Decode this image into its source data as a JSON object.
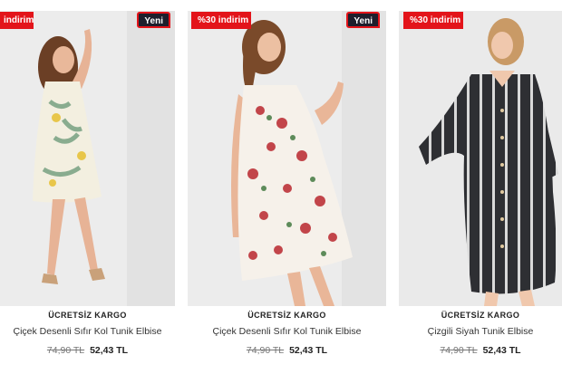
{
  "products": [
    {
      "discount_badge": "indirim",
      "new_badge": "Yeni",
      "shipping": "ÜCRETSİZ KARGO",
      "name": "Çiçek Desenli Sıfır Kol Tunik Elbise",
      "old_price": "74,90 TL",
      "new_price": "52,43 TL"
    },
    {
      "discount_badge": "%30 indirim",
      "new_badge": "Yeni",
      "shipping": "ÜCRETSİZ KARGO",
      "name": "Çiçek Desenli Sıfır Kol Tunik Elbise",
      "old_price": "74,90 TL",
      "new_price": "52,43 TL"
    },
    {
      "discount_badge": "%30 indirim",
      "shipping": "ÜCRETSİZ KARGO",
      "name": "Çizgili Siyah Tunik Elbise",
      "old_price": "74,90 TL",
      "new_price": "52,43 TL"
    }
  ],
  "colors": {
    "discount_badge": "#e3141a",
    "new_badge": "#1e1e2c",
    "photo_background": "#e9e9e9"
  }
}
